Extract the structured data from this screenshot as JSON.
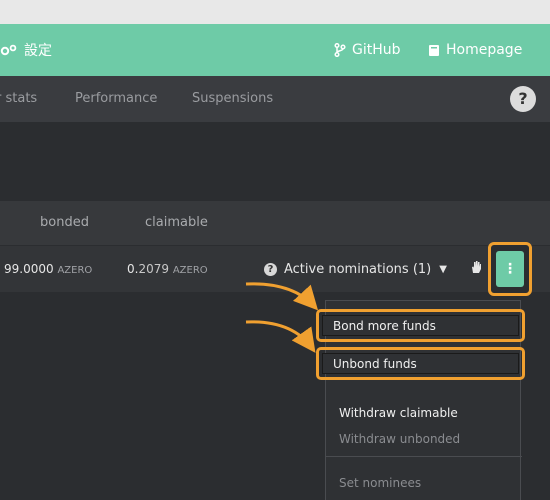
{
  "navbar": {
    "brand_label": "設定",
    "github_label": "GitHub",
    "homepage_label": "Homepage"
  },
  "subnav": {
    "tabs": [
      "r stats",
      "Performance",
      "Suspensions"
    ],
    "help_label": "?"
  },
  "table": {
    "headers": {
      "bonded": "bonded",
      "claimable": "claimable"
    },
    "row": {
      "bonded_value": "99.0000",
      "bonded_unit": "AZERO",
      "claimable_int": "0.",
      "claimable_frac": "2079",
      "claimable_unit": "AZERO",
      "nominations_label": "Active nominations (1)",
      "kebab_label": "⋮"
    }
  },
  "menu": {
    "items": [
      {
        "label": "Bond more funds"
      },
      {
        "label": "Unbond funds"
      },
      {
        "label": "Withdraw claimable"
      },
      {
        "label": "Withdraw unbonded"
      },
      {
        "label": "Set nominees"
      }
    ]
  },
  "colors": {
    "accent": "#6ecba7",
    "highlight": "#f0a030"
  }
}
